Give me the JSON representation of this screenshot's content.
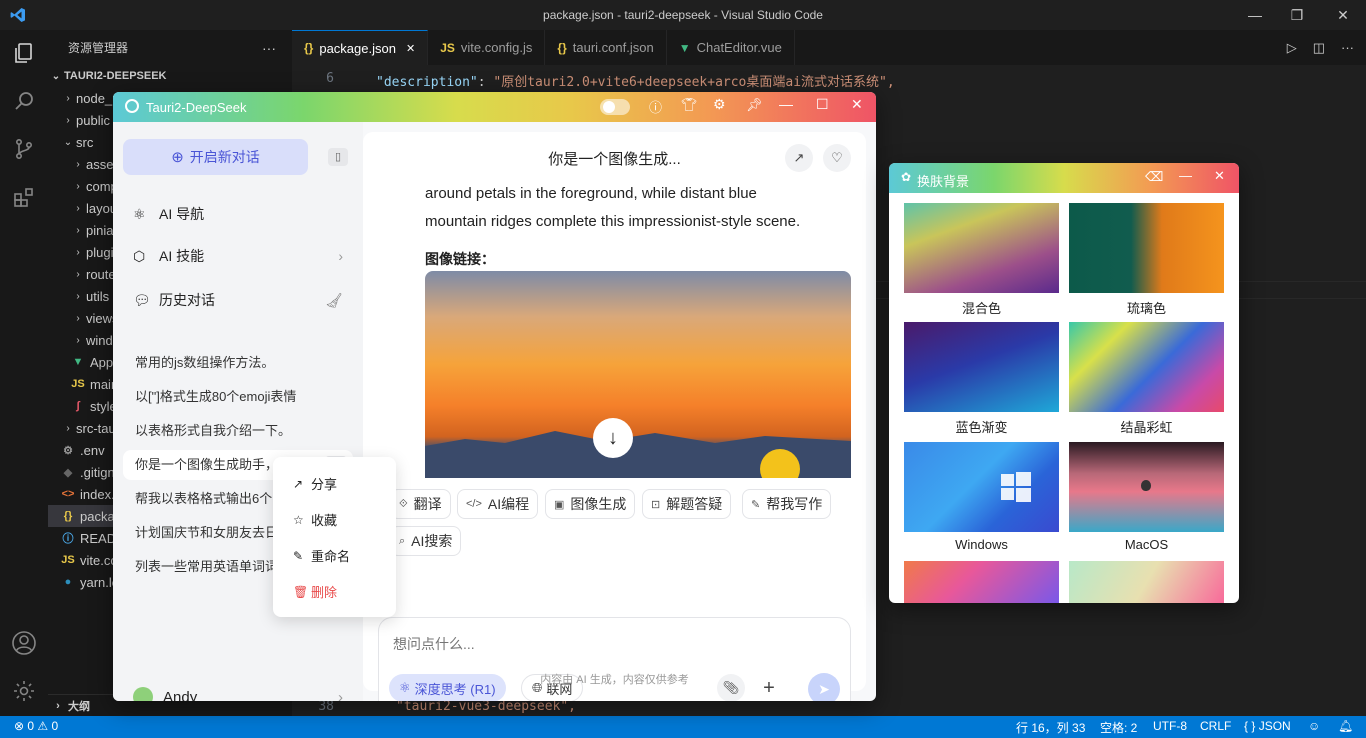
{
  "vscode": {
    "window_title": "package.json - tauri2-deepseek - Visual Studio Code",
    "explorer_title": "资源管理器",
    "project": "TAURI2-DEEPSEEK",
    "tree": [
      {
        "label": "node_modules",
        "type": "folder",
        "indent": 1,
        "open": false
      },
      {
        "label": "public",
        "type": "folder",
        "indent": 1,
        "open": false
      },
      {
        "label": "src",
        "type": "folder",
        "indent": 1,
        "open": true
      },
      {
        "label": "assets",
        "type": "folder",
        "indent": 2,
        "open": false
      },
      {
        "label": "components",
        "type": "folder",
        "indent": 2,
        "open": false
      },
      {
        "label": "layouts",
        "type": "folder",
        "indent": 2,
        "open": false
      },
      {
        "label": "pinia",
        "type": "folder",
        "indent": 2,
        "open": false
      },
      {
        "label": "plugins",
        "type": "folder",
        "indent": 2,
        "open": false
      },
      {
        "label": "router",
        "type": "folder",
        "indent": 2,
        "open": false
      },
      {
        "label": "utils",
        "type": "folder",
        "indent": 2,
        "open": false
      },
      {
        "label": "views",
        "type": "folder",
        "indent": 2,
        "open": false
      },
      {
        "label": "windows",
        "type": "folder",
        "indent": 2,
        "open": false
      },
      {
        "label": "App.vue",
        "type": "vue",
        "indent": 2
      },
      {
        "label": "main.js",
        "type": "js",
        "indent": 2
      },
      {
        "label": "style.scss",
        "type": "style",
        "indent": 2
      },
      {
        "label": "src-tauri",
        "type": "folder",
        "indent": 1,
        "open": false
      },
      {
        "label": ".env",
        "type": "env",
        "indent": 1
      },
      {
        "label": ".gitignore",
        "type": "git",
        "indent": 1
      },
      {
        "label": "index.html",
        "type": "html",
        "indent": 1
      },
      {
        "label": "package.json",
        "type": "json",
        "indent": 1,
        "selected": true
      },
      {
        "label": "README.md",
        "type": "md",
        "indent": 1
      },
      {
        "label": "vite.config.js",
        "type": "js",
        "indent": 1
      },
      {
        "label": "yarn.lock",
        "type": "yarn",
        "indent": 1
      }
    ],
    "outline": "大纲",
    "tabs": [
      {
        "label": "package.json",
        "icon": "{}",
        "active": true,
        "color": "#e8c84a"
      },
      {
        "label": "vite.config.js",
        "icon": "JS",
        "active": false,
        "color": "#e8c84a"
      },
      {
        "label": "tauri.conf.json",
        "icon": "{}",
        "active": false,
        "color": "#e8c84a"
      },
      {
        "label": "ChatEditor.vue",
        "icon": "▼",
        "active": false,
        "color": "#41b883"
      }
    ],
    "code_lines": [
      {
        "num": "6",
        "key": "\"description\"",
        "value": "\"原创tauri2.0+vite6+deepseek+arco桌面端ai流式对话系统\","
      },
      {
        "num": "38",
        "key": "",
        "value": "\"tauri2-vue3-deepseek\","
      }
    ],
    "status": {
      "errors": "0",
      "warnings": "0",
      "position": "行 16，列 33",
      "spaces": "空格: 2",
      "encoding": "UTF-8",
      "eol": "CRLF",
      "language": "JSON"
    }
  },
  "app": {
    "title": "Tauri2-DeepSeek",
    "new_chat": "开启新对话",
    "nav": [
      {
        "label": "AI 导航"
      },
      {
        "label": "AI 技能"
      },
      {
        "label": "历史对话"
      }
    ],
    "history": [
      "常用的js数组操作方法。",
      "以[\"]格式生成80个emoji表情",
      "以表格形式自我介绍一下。",
      "你是一个图像生成助手，请根据",
      "帮我以表格格式输出6个",
      "计划国庆节和女朋友去日",
      "列表一些常用英语单词词"
    ],
    "user": "Andy",
    "context_menu": [
      {
        "label": "分享",
        "icon": "share-icon"
      },
      {
        "label": "收藏",
        "icon": "star-icon"
      },
      {
        "label": "重命名",
        "icon": "edit-icon"
      },
      {
        "label": "删除",
        "icon": "delete-icon",
        "danger": true
      }
    ],
    "chat_title": "你是一个图像生成...",
    "message_text_1": "around petals in the foreground, while distant blue",
    "message_text_2": "mountain ridges complete this impressionist-style scene.",
    "image_link_label": "图像链接：",
    "skills": [
      "翻译",
      "AI编程",
      "图像生成",
      "解题答疑",
      "帮我写作",
      "AI搜索"
    ],
    "input_placeholder": "想问点什么...",
    "deep_think": "深度思考 (R1)",
    "web_search": "联网",
    "footer_note": "内容由 AI 生成，内容仅供参考"
  },
  "skin": {
    "title": "换肤背景",
    "items": [
      {
        "label": "混合色"
      },
      {
        "label": "琉璃色"
      },
      {
        "label": "蓝色渐变"
      },
      {
        "label": "结晶彩虹"
      },
      {
        "label": "Windows"
      },
      {
        "label": "MacOS"
      }
    ]
  }
}
